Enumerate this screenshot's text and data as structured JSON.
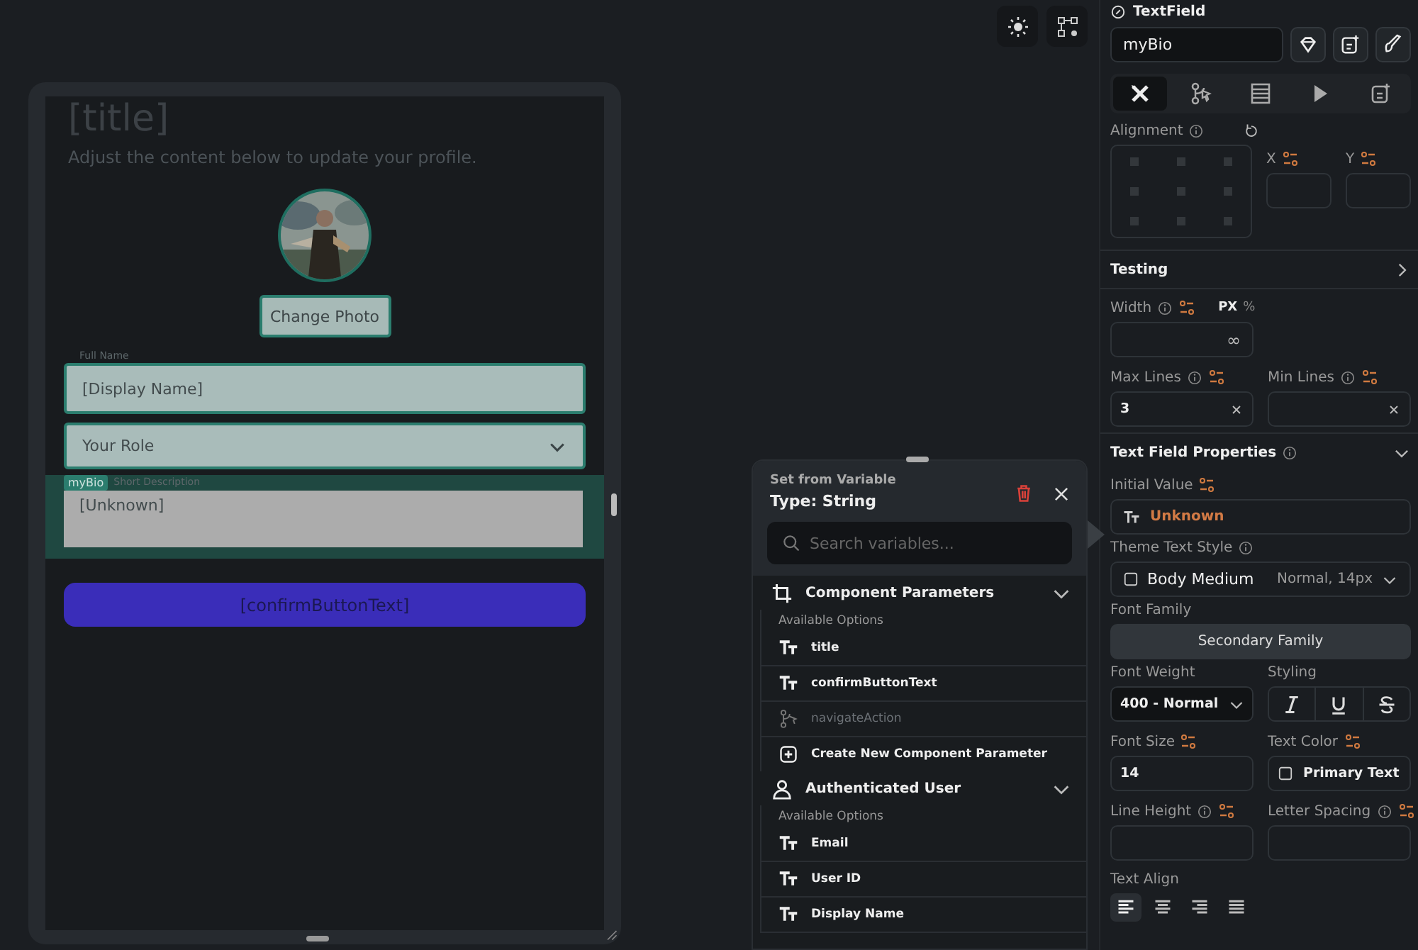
{
  "canvas": {
    "title": "[title]",
    "subtitle": "Adjust the content below to update your profile.",
    "photo_button": "Change Photo",
    "fields": [
      {
        "kind": "text",
        "label": "Full Name",
        "value": "[Display Name]",
        "selected": false
      },
      {
        "kind": "dropdown",
        "value": "Your Role",
        "selected": false
      },
      {
        "kind": "multiline",
        "label": "Short Description",
        "value": "[Unknown]",
        "badge": "myBio",
        "selected": true
      }
    ],
    "confirm_button": "[confirmButtonText]"
  },
  "variable_popup": {
    "caption": "Set from Variable",
    "title": "Type: String",
    "search_placeholder": "Search variables...",
    "groups": [
      {
        "kind": "component",
        "title": "Component Parameters",
        "expanded": true,
        "subtitle": "Available Options",
        "items": [
          {
            "kind": "text",
            "label": "title",
            "disabled": false
          },
          {
            "kind": "text",
            "label": "confirmButtonText",
            "disabled": false
          },
          {
            "kind": "action",
            "label": "navigateAction",
            "disabled": true
          },
          {
            "kind": "create",
            "label": "Create New Component Parameter",
            "disabled": false
          }
        ]
      },
      {
        "kind": "user",
        "title": "Authenticated User",
        "expanded": true,
        "subtitle": "Available Options",
        "items": [
          {
            "kind": "text",
            "label": "Email",
            "disabled": false
          },
          {
            "kind": "text",
            "label": "User ID",
            "disabled": false
          },
          {
            "kind": "text",
            "label": "Display Name",
            "disabled": false
          }
        ]
      }
    ]
  },
  "properties_panel": {
    "widget_type": "TextField",
    "widget_name": "myBio",
    "tabs": [
      {
        "kind": "design",
        "selected": true
      },
      {
        "kind": "actions",
        "selected": false
      },
      {
        "kind": "layout",
        "selected": false
      },
      {
        "kind": "play",
        "selected": false
      },
      {
        "kind": "notes",
        "selected": false
      }
    ],
    "alignment_label": "Alignment",
    "x_label": "X",
    "y_label": "Y",
    "testing_label": "Testing",
    "width_label": "Width",
    "units": [
      {
        "label": "PX",
        "selected": true
      },
      {
        "label": "%",
        "selected": false
      }
    ],
    "width_value": "∞",
    "max_lines_label": "Max Lines",
    "max_lines_value": "3",
    "min_lines_label": "Min Lines",
    "section_title": "Text Field Properties",
    "section_expanded": true,
    "initial_value_label": "Initial Value",
    "initial_value": "Unknown",
    "theme_style_label": "Theme Text Style",
    "theme_style": "Body Medium",
    "theme_style_detail": "Normal, 14px",
    "font_family_label": "Font Family",
    "font_family": "Secondary Family",
    "font_weight_label": "Font Weight",
    "font_weight": "400 - Normal",
    "styling_label": "Styling",
    "styling": [
      {
        "kind": "italic",
        "selected": false
      },
      {
        "kind": "underline",
        "selected": false
      },
      {
        "kind": "strike",
        "selected": false
      }
    ],
    "font_size_label": "Font Size",
    "font_size": "14",
    "text_color_label": "Text Color",
    "text_color": "Primary Text",
    "line_height_label": "Line Height",
    "letter_spacing_label": "Letter Spacing",
    "text_align_label": "Text Align",
    "text_align": [
      {
        "kind": "left",
        "selected": true
      },
      {
        "kind": "center",
        "selected": false
      },
      {
        "kind": "right",
        "selected": false
      },
      {
        "kind": "justify",
        "selected": false
      }
    ]
  }
}
